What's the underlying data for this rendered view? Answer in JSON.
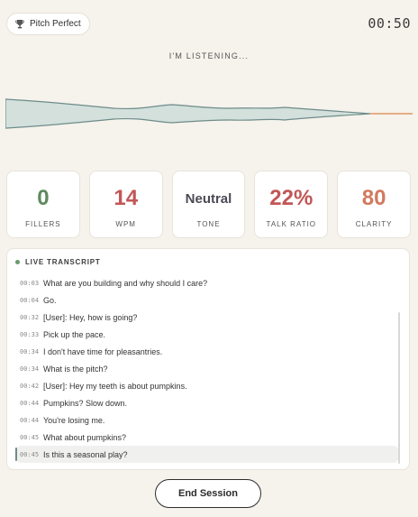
{
  "app": {
    "name": "Pitch Perfect",
    "icon": "trophy-icon"
  },
  "timer": "00:50",
  "status": "I'M LISTENING...",
  "metrics": [
    {
      "value": "0",
      "label": "FILLERS",
      "color": "#5d8a5d"
    },
    {
      "value": "14",
      "label": "WPM",
      "color": "#c25656"
    },
    {
      "value": "Neutral",
      "label": "TONE",
      "color": "#4a4a55"
    },
    {
      "value": "22%",
      "label": "TALK RATIO",
      "color": "#c25656"
    },
    {
      "value": "80",
      "label": "CLARITY",
      "color": "#d27a5e"
    }
  ],
  "transcript": {
    "title": "LIVE TRANSCRIPT",
    "entries": [
      {
        "time": "00:03",
        "text": "What are you building and why should I care?"
      },
      {
        "time": "00:04",
        "text": "Go."
      },
      {
        "time": "00:32",
        "text": "[User]: Hey, how is going?"
      },
      {
        "time": "00:33",
        "text": "Pick up the pace."
      },
      {
        "time": "00:34",
        "text": "I don't have time for pleasantries."
      },
      {
        "time": "00:34",
        "text": "What is the pitch?"
      },
      {
        "time": "00:42",
        "text": "[User]: Hey my teeth is about pumpkins."
      },
      {
        "time": "00:44",
        "text": "Pumpkins? Slow down."
      },
      {
        "time": "00:44",
        "text": "You're losing me."
      },
      {
        "time": "00:45",
        "text": "What about pumpkins?"
      },
      {
        "time": "00:45",
        "text": "Is this a seasonal play?"
      }
    ]
  },
  "end_button": "End Session",
  "colors": {
    "wave_fill": "#d3e0dc",
    "wave_stroke": "#6e8c8a",
    "wave_tail": "#d9874a"
  }
}
